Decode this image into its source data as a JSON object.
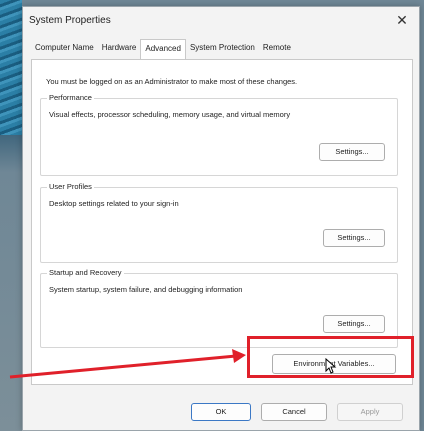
{
  "window": {
    "title": "System Properties",
    "close_glyph": "✕"
  },
  "tabs": [
    {
      "label": "Computer Name",
      "active": false
    },
    {
      "label": "Hardware",
      "active": false
    },
    {
      "label": "Advanced",
      "active": true
    },
    {
      "label": "System Protection",
      "active": false
    },
    {
      "label": "Remote",
      "active": false
    }
  ],
  "admin_note": "You must be logged on as an Administrator to make most of these changes.",
  "groups": {
    "performance": {
      "title": "Performance",
      "description": "Visual effects, processor scheduling, memory usage, and virtual memory",
      "button": "Settings..."
    },
    "user_profiles": {
      "title": "User Profiles",
      "description": "Desktop settings related to your sign-in",
      "button": "Settings..."
    },
    "startup_recovery": {
      "title": "Startup and Recovery",
      "description": "System startup, system failure, and debugging information",
      "button": "Settings..."
    }
  },
  "environment_button": "Environment Variables...",
  "footer": {
    "ok": "OK",
    "cancel": "Cancel",
    "apply": "Apply"
  },
  "annotation": {
    "color": "#e0202a",
    "icons": [
      "arrow-icon",
      "mouse-cursor-icon"
    ]
  }
}
